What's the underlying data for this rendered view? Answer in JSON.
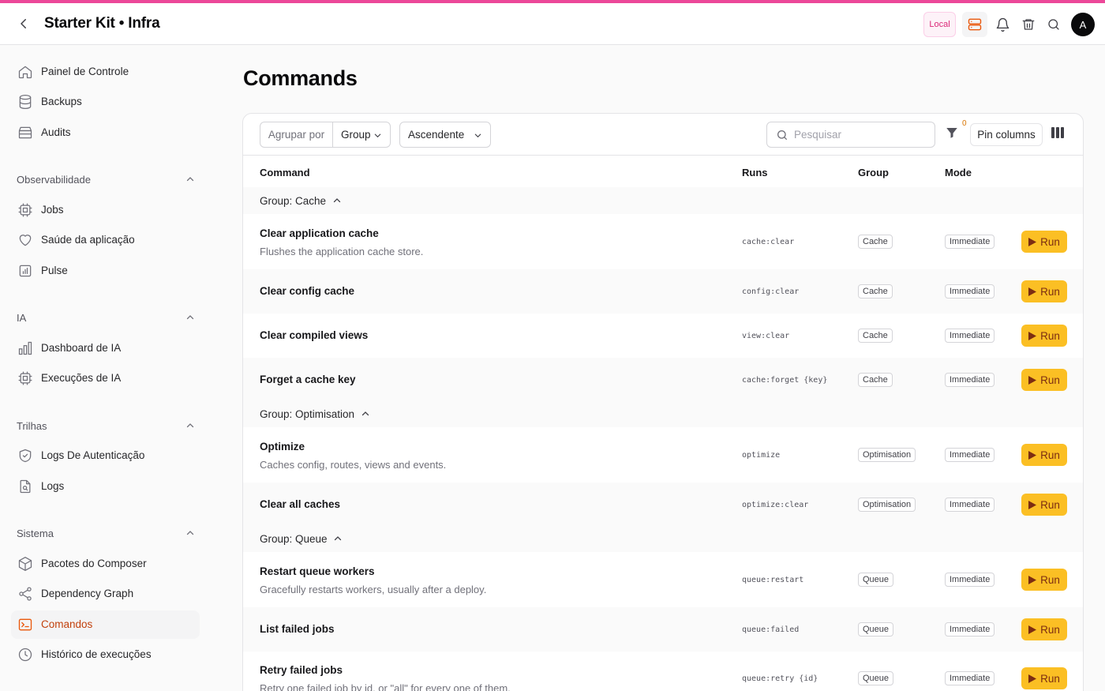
{
  "header": {
    "title": "Starter Kit • Infra",
    "env_badge": "Local",
    "avatar_initial": "A"
  },
  "sidebar": {
    "top_items": [
      {
        "label": "Painel de Controle",
        "icon": "home-icon"
      },
      {
        "label": "Backups",
        "icon": "database-icon"
      },
      {
        "label": "Audits",
        "icon": "archive-icon"
      }
    ],
    "sections": [
      {
        "title": "Observabilidade",
        "items": [
          {
            "label": "Jobs",
            "icon": "chip-icon"
          },
          {
            "label": "Saúde da aplicação",
            "icon": "heart-icon"
          },
          {
            "label": "Pulse",
            "icon": "chart-square-icon"
          }
        ]
      },
      {
        "title": "IA",
        "items": [
          {
            "label": "Dashboard de IA",
            "icon": "bar-chart-icon"
          },
          {
            "label": "Execuções de IA",
            "icon": "chip-icon"
          }
        ]
      },
      {
        "title": "Trilhas",
        "items": [
          {
            "label": "Logs De Autenticação",
            "icon": "shield-check-icon"
          },
          {
            "label": "Logs",
            "icon": "file-search-icon"
          }
        ]
      },
      {
        "title": "Sistema",
        "items": [
          {
            "label": "Pacotes do Composer",
            "icon": "cube-icon"
          },
          {
            "label": "Dependency Graph",
            "icon": "share-icon"
          },
          {
            "label": "Comandos",
            "icon": "terminal-icon",
            "active": true
          },
          {
            "label": "Histórico de execuções",
            "icon": "clock-icon"
          }
        ]
      }
    ]
  },
  "main": {
    "title": "Commands",
    "toolbar": {
      "group_by_label": "Agrupar por",
      "group_by_value": "Group",
      "sort_value": "Ascendente",
      "search_placeholder": "Pesquisar",
      "filter_count": "0",
      "pin_columns_label": "Pin columns"
    },
    "columns": {
      "command": "Command",
      "runs": "Runs",
      "group": "Group",
      "mode": "Mode"
    },
    "groups": [
      {
        "label": "Group: Cache"
      },
      {
        "label": "Group: Optimisation"
      },
      {
        "label": "Group: Queue"
      }
    ],
    "rows": [
      {
        "title": "Clear application cache",
        "desc": "Flushes the application cache store.",
        "sig": "cache:clear",
        "group": "Cache",
        "mode": "Immediate",
        "action": "Run"
      },
      {
        "title": "Clear config cache",
        "desc": "",
        "sig": "config:clear",
        "group": "Cache",
        "mode": "Immediate",
        "action": "Run"
      },
      {
        "title": "Clear compiled views",
        "desc": "",
        "sig": "view:clear",
        "group": "Cache",
        "mode": "Immediate",
        "action": "Run"
      },
      {
        "title": "Forget a cache key",
        "desc": "",
        "sig": "cache:forget {key}",
        "group": "Cache",
        "mode": "Immediate",
        "action": "Run"
      },
      {
        "title": "Optimize",
        "desc": "Caches config, routes, views and events.",
        "sig": "optimize",
        "group": "Optimisation",
        "mode": "Immediate",
        "action": "Run"
      },
      {
        "title": "Clear all caches",
        "desc": "",
        "sig": "optimize:clear",
        "group": "Optimisation",
        "mode": "Immediate",
        "action": "Run"
      },
      {
        "title": "Restart queue workers",
        "desc": "Gracefully restarts workers, usually after a deploy.",
        "sig": "queue:restart",
        "group": "Queue",
        "mode": "Immediate",
        "action": "Run"
      },
      {
        "title": "List failed jobs",
        "desc": "",
        "sig": "queue:failed",
        "group": "Queue",
        "mode": "Immediate",
        "action": "Run"
      },
      {
        "title": "Retry failed jobs",
        "desc": "Retry one failed job by id, or \"all\" for every one of them.",
        "sig": "queue:retry {id}",
        "group": "Queue",
        "mode": "Immediate",
        "action": "Run"
      }
    ]
  },
  "colors": {
    "accent": "#ec4899",
    "run_button": "#fbbf24",
    "active_nav_text": "#c2410c"
  }
}
